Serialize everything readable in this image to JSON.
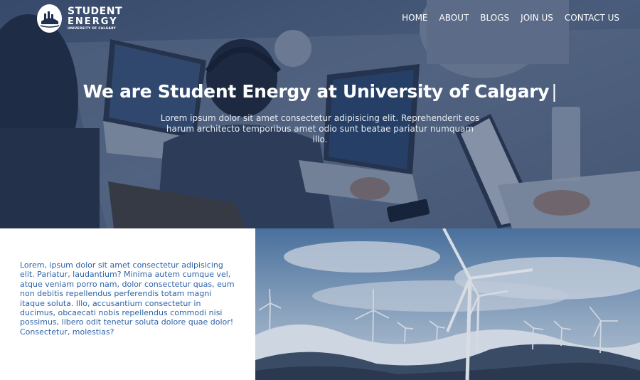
{
  "brand": {
    "line1": "STUDENT",
    "line2": "ENERGY",
    "line3": "UNIVERSITY OF CALGARY",
    "logo_icon": "student-energy-logo"
  },
  "nav": {
    "items": [
      {
        "label": "HOME"
      },
      {
        "label": "ABOUT"
      },
      {
        "label": "BLOGS"
      },
      {
        "label": "JOIN US"
      },
      {
        "label": "CONTACT US"
      }
    ]
  },
  "hero": {
    "title": "We are Student Energy at University of Calgary",
    "cursor": "|",
    "subtitle": "Lorem ipsum dolor sit amet consectetur adipisicing elit. Reprehenderit eos harum architecto temporibus amet odio sunt beatae pariatur numquam illo."
  },
  "about": {
    "text": "Lorem, ipsum dolor sit amet consectetur adipisicing elit. Pariatur, laudantium? Minima autem cumque vel, atque veniam porro nam, dolor consectetur quas, eum non debitis repellendus perferendis totam magni itaque soluta. Illo, accusantium consectetur in ducimus, obcaecati nobis repellendus commodi nisi possimus, libero odit tenetur soluta dolore quae dolor! Consectetur, molestias?"
  },
  "colors": {
    "accent_text": "#2e63a8",
    "overlay": "#1e345c",
    "nav_text": "#ffffff"
  }
}
